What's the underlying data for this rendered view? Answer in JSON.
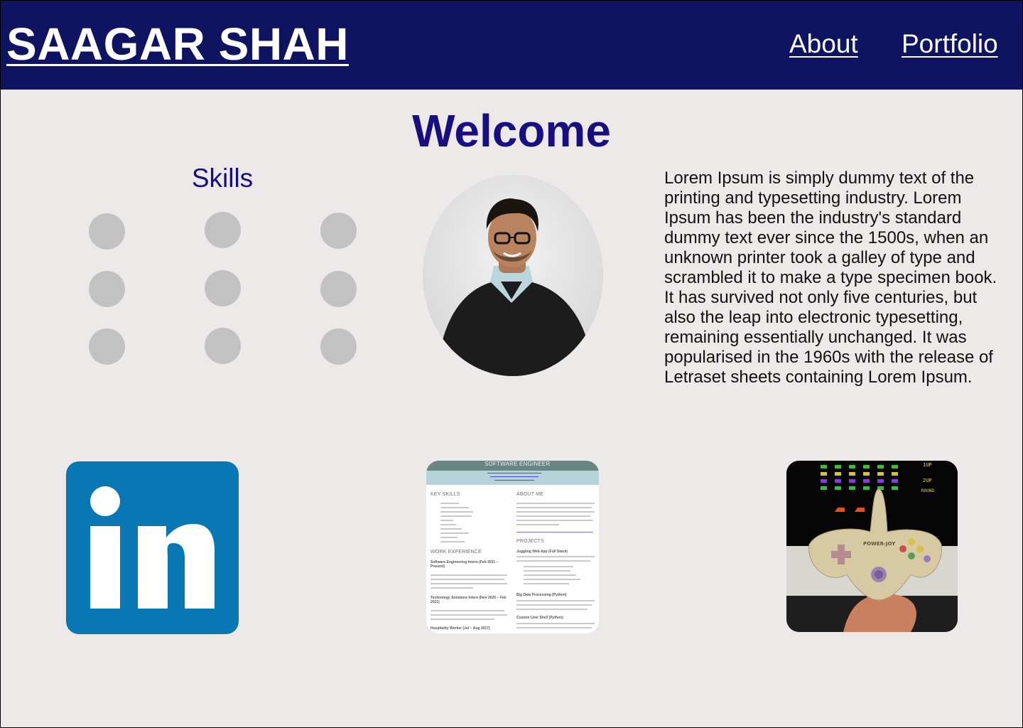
{
  "header": {
    "brand": "SAAGAR SHAH",
    "nav": [
      {
        "label": "About"
      },
      {
        "label": "Portfolio"
      }
    ]
  },
  "main": {
    "welcome": "Welcome",
    "skills_title": "Skills",
    "about_text": "Lorem Ipsum is simply dummy text of the printing and typesetting industry. Lorem Ipsum has been the industry's standard dummy text ever since the 1500s, when an unknown printer took a galley of type and scrambled it to make a type specimen book. It has survived not only five centuries, but also the leap into electronic typesetting, remaining essentially unchanged. It was popularised in the 1960s with the release of Letraset sheets containing Lorem Ipsum."
  },
  "tiles": {
    "cv": {
      "title": "SOFTWARE ENGINEER",
      "key_skills": "KEY SKILLS",
      "about_me": "ABOUT ME",
      "work_experience": "WORK EXPERIENCE",
      "projects": "PROJECTS",
      "job1": "Software Engineering Intern (Feb 2021 – Present)",
      "job2": "Technology Solutions Intern (Nov 2020 – Feb 2021)",
      "job3": "Hospitality Worker (Jul – Aug 2017)",
      "proj1": "Juggling Web App (Full Stack)",
      "proj2": "Big Data Processing (Python)",
      "proj3": "Custom Unix Shell (Python)"
    },
    "game": {
      "controller_label": "POWER-JOY",
      "hud_1up": "1UP",
      "hud_2up": "2UP",
      "hud_round": "ROUND"
    }
  },
  "colors": {
    "header_bg": "#0e1461",
    "page_bg": "#ede9e8",
    "accent": "#170f80",
    "linkedin_blue": "#0a77b5",
    "skill_dot": "#c2c2c2"
  }
}
